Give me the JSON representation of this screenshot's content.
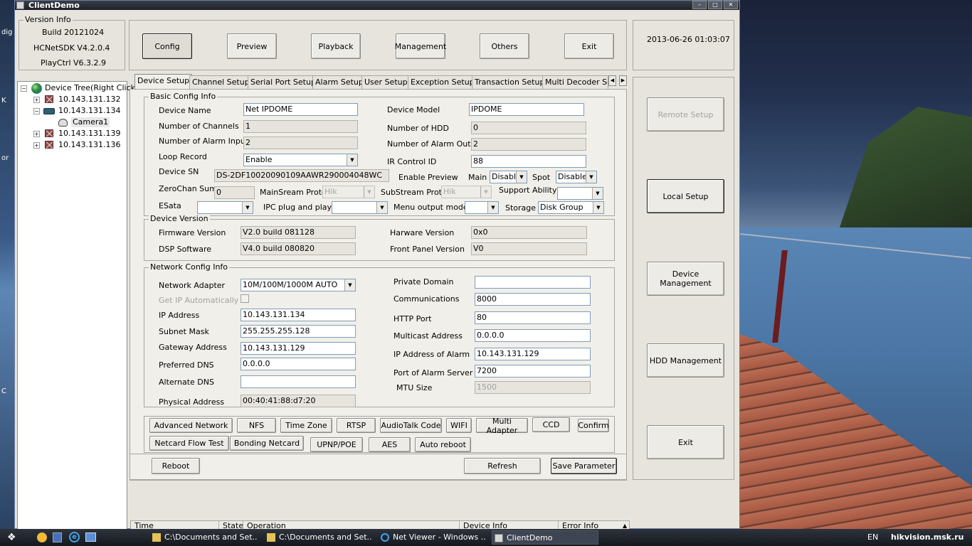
{
  "window": {
    "title": "ClientDemo"
  },
  "version_info": {
    "title": "Version Info",
    "build": "Build 20121024",
    "sdk": "HCNetSDK V4.2.0.4",
    "playctrl": "PlayCtrl V6.3.2.9"
  },
  "top_buttons": [
    "Config",
    "Preview",
    "Playback",
    "Management",
    "Others",
    "Exit"
  ],
  "datetime": "2013-06-26  01:03:07",
  "tree": {
    "root": "Device Tree(Right Click",
    "items": [
      "10.143.131.132",
      "10.143.131.134",
      "Camera1",
      "10.143.131.139",
      "10.143.131.136"
    ]
  },
  "tabs": [
    "Device Setup",
    "Channel Setup",
    "Serial Port Setup",
    "Alarm Setup",
    "User Setup",
    "Exception Setup",
    "Transaction Setup",
    "Multi Decoder Set"
  ],
  "basic": {
    "title": "Basic Config Info",
    "device_name_label": "Device Name",
    "device_name": "Net IPDOME",
    "device_model_label": "Device Model",
    "device_model": "IPDOME",
    "channels_label": "Number of Channels",
    "channels": "1",
    "hdd_label": "Number of HDD",
    "hdd": "0",
    "alarm_in_label": "Number of Alarm Input",
    "alarm_in": "2",
    "alarm_out_label": "Number of Alarm Output",
    "alarm_out": "2",
    "loop_label": "Loop Record",
    "loop": "Enable",
    "ir_label": "IR Control ID",
    "ir": "88",
    "sn_label": "Device SN",
    "sn": "DS-2DF10020090109AAWR290004048WC",
    "enable_preview_label": "Enable Preview",
    "main_label": "Main",
    "main": "Disable",
    "spot_label": "Spot",
    "spot": "Disable",
    "zerochan_label": "ZeroChan Sum",
    "zerochan": "0",
    "mainstream_label": "MainSream Proto",
    "mainstream": "Hik",
    "substream_label": "SubStream Proto",
    "substream": "Hik",
    "support_label": "Support Ability",
    "support": "",
    "esata_label": "ESata",
    "esata": "",
    "ipc_label": "IPC plug and play",
    "ipc": "",
    "menu_label": "Menu output mode",
    "menu": "",
    "storage_label": "Storage",
    "storage": "Disk Group"
  },
  "version": {
    "title": "Device Version",
    "fw_label": "Firmware Version",
    "fw": "V2.0 build 081128",
    "hw_label": "Harware Version",
    "hw": "0x0",
    "dsp_label": "DSP Software",
    "dsp": "V4.0 build 080820",
    "fp_label": "Front Panel Version",
    "fp": "V0"
  },
  "network": {
    "title": "Network Config Info",
    "adapter_label": "Network Adapter",
    "adapter": "10M/100M/1000M AUTO",
    "auto_ip_label": "Get IP Automatically",
    "ip_label": "IP Address",
    "ip": "10.143.131.134",
    "mask_label": "Subnet Mask",
    "mask": "255.255.255.128",
    "gw_label": "Gateway Address",
    "gw": "10.143.131.129",
    "dns1_label": "Preferred DNS",
    "dns1": "0.0.0.0",
    "dns2_label": "Alternate DNS",
    "dns2": "",
    "mac_label": "Physical Address",
    "mac": "00:40:41:88:d7:20",
    "domain_label": "Private Domain",
    "domain": "",
    "comm_label": "Communications",
    "comm": "8000",
    "http_label": "HTTP Port",
    "http": "80",
    "mcast_label": "Multicast Address",
    "mcast": "0.0.0.0",
    "alarm_ip_label": "IP Address of Alarm",
    "alarm_ip": "10.143.131.129",
    "alarm_port_label": "Port of Alarm Server",
    "alarm_port": "7200",
    "mtu_label": "MTU Size",
    "mtu": "1500"
  },
  "net_buttons_row1": [
    "Advanced Network",
    "NFS",
    "Time Zone",
    "RTSP",
    "AudioTalk Code",
    "WIFI",
    "Multi Adapter",
    "CCD",
    "Confirm"
  ],
  "net_buttons_row2": [
    "Netcard Flow Test",
    "Bonding Netcard",
    "UPNP/POE",
    "AES",
    "Auto reboot"
  ],
  "bottom_buttons": {
    "reboot": "Reboot",
    "refresh": "Refresh",
    "save": "Save Parameter"
  },
  "right_buttons": [
    "Remote Setup",
    "Local Setup",
    "Device Management",
    "HDD Management",
    "Exit"
  ],
  "log_columns": [
    "Time",
    "State",
    "Operation",
    "Device Info",
    "Error Info"
  ],
  "taskbar": {
    "items": [
      "C:\\Documents and Set...",
      "C:\\Documents and Set...",
      "Net Viewer - Windows ...",
      "ClientDemo"
    ],
    "lang": "EN",
    "watermark": "hikvision.msk.ru"
  },
  "desktop_labels": [
    "dig",
    "K",
    "or",
    "C"
  ]
}
